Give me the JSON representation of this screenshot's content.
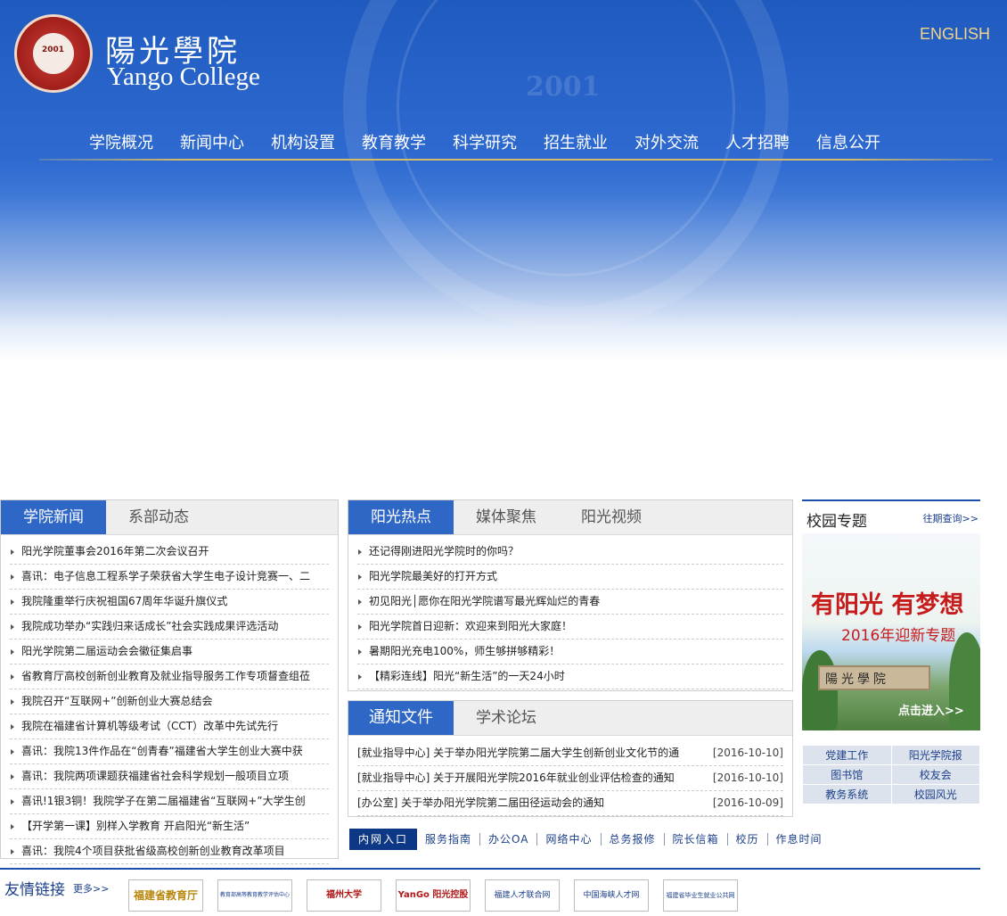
{
  "header": {
    "logo_cn": "陽光學院",
    "logo_en": "Yango College",
    "logo_year": "2001",
    "watermark_year": "2001",
    "language_link": "ENGLISH"
  },
  "nav": [
    "学院概况",
    "新闻中心",
    "机构设置",
    "教育教学",
    "科学研究",
    "招生就业",
    "对外交流",
    "人才招聘",
    "信息公开"
  ],
  "news_panel": {
    "tabs": [
      "学院新闻",
      "系部动态"
    ],
    "items": [
      "阳光学院董事会2016年第二次会议召开",
      "喜讯：电子信息工程系学子荣获省大学生电子设计竞赛一、二",
      "我院隆重举行庆祝祖国67周年华诞升旗仪式",
      "我院成功举办“实践归来话成长”社会实践成果评选活动",
      "阳光学院第二届运动会会徽征集启事",
      "省教育厅高校创新创业教育及就业指导服务工作专项督查组莅",
      "我院召开“互联网+”创新创业大赛总结会",
      "我院在福建省计算机等级考试（CCT）改革中先试先行",
      "喜讯：我院13件作品在“创青春”福建省大学生创业大赛中获",
      "喜讯：我院两项课题获福建省社会科学规划一般项目立项",
      "喜讯!1银3铜！我院学子在第二届福建省“互联网+”大学生创",
      "【开学第一课】别样入学教育 开启阳光“新生活”",
      "喜讯：我院4个项目获批省级高校创新创业教育改革项目"
    ]
  },
  "hot_panel": {
    "tabs": [
      "阳光热点",
      "媒体聚焦",
      "阳光视频"
    ],
    "items": [
      "还记得刚进阳光学院时的你吗？",
      "阳光学院最美好的打开方式",
      "初见阳光│愿你在阳光学院谱写最光辉灿烂的青春",
      "阳光学院首日迎新：欢迎来到阳光大家庭！",
      "暑期阳光充电100%，师生够拼够精彩！",
      "【精彩连线】阳光“新生活”的一天24小时"
    ]
  },
  "notice_panel": {
    "tabs": [
      "通知文件",
      "学术论坛"
    ],
    "items": [
      {
        "title": "[就业指导中心] 关于举办阳光学院第二届大学生创新创业文化节的通",
        "date": "[2016-10-10]"
      },
      {
        "title": "[就业指导中心] 关于开展阳光学院2016年就业创业评估检查的通知",
        "date": "[2016-10-10]"
      },
      {
        "title": "[办公室] 关于举办阳光学院第二届田径运动会的通知",
        "date": "[2016-10-09]"
      }
    ]
  },
  "campus": {
    "title": "校园专题",
    "more": "往期查询>>",
    "promo_line1": "有阳光 有梦想",
    "promo_line2": "2016年迎新专题",
    "promo_sign": "陽光學院",
    "promo_button": "点击进入>>"
  },
  "quick_links": [
    "党建工作",
    "阳光学院报",
    "图书馆",
    "校友会",
    "教务系统",
    "校园风光"
  ],
  "bottom_bar": [
    "内网入口",
    "服务指南",
    "办公OA",
    "网络中心",
    "总务报修",
    "院长信箱",
    "校历",
    "作息时间"
  ],
  "friends": {
    "title": "友情链接",
    "more": "更多>>",
    "links": [
      "福建省教育厅",
      "教育部高等教育教学评估中心",
      "福州大学",
      "YanGo 阳光控股",
      "福建人才联合网",
      "中国海峡人才网",
      "福建省毕业生就业公共网"
    ]
  },
  "colors": {
    "primary_blue": "#2e67c6",
    "nav_gold": "#d4bb68",
    "english_gold": "#f3d488",
    "link_blue": "#1b3f8a",
    "promo_red": "#c71c1c"
  }
}
